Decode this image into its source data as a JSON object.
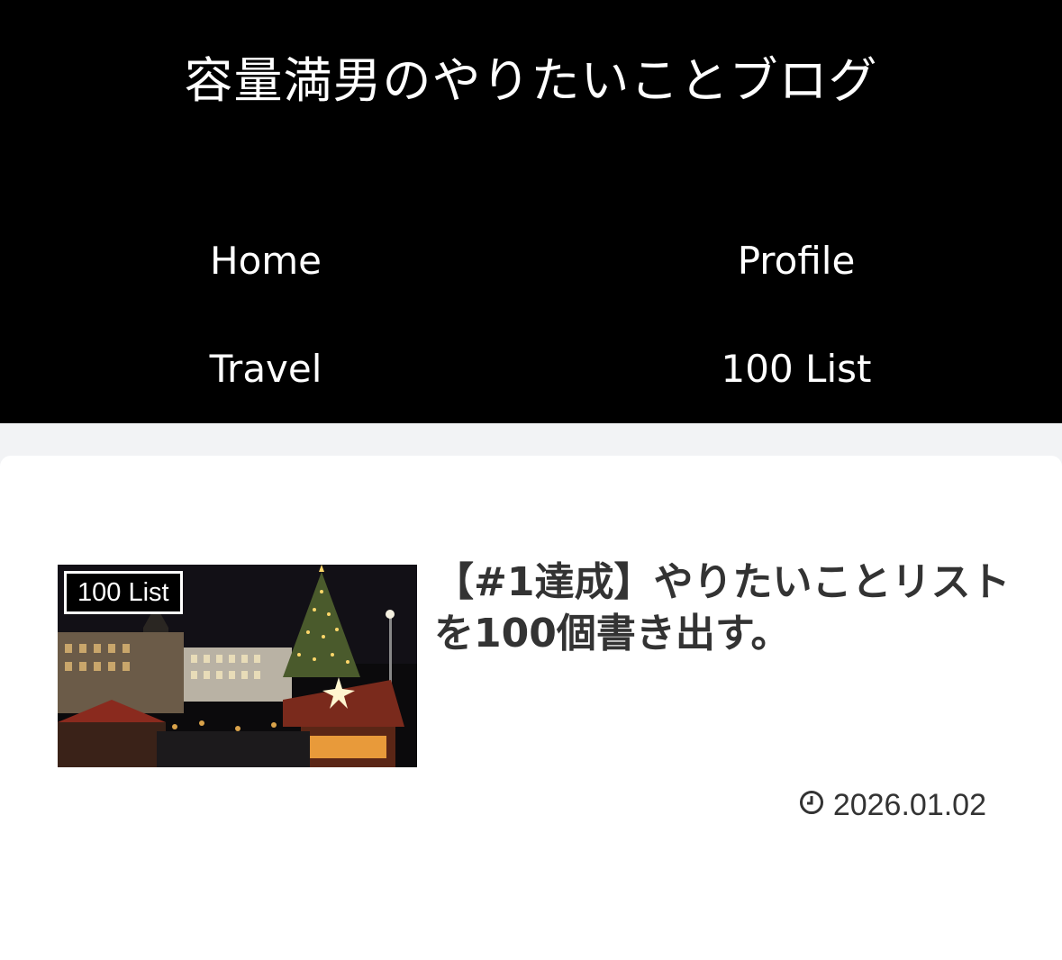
{
  "site": {
    "title": "容量満男のやりたいことブログ"
  },
  "nav": {
    "items": [
      {
        "label": "Home"
      },
      {
        "label": "Profile"
      },
      {
        "label": "Travel"
      },
      {
        "label": "100 List"
      }
    ]
  },
  "post": {
    "category": "100 List",
    "title": "【#1達成】やりたいことリストを100個書き出す。",
    "date": "2026.01.02",
    "thumbnail_icon": "christmas-market-photo"
  },
  "icons": {
    "date": "clock-icon"
  },
  "colors": {
    "header_bg": "#000000",
    "page_bg": "#f2f3f5",
    "card_bg": "#ffffff",
    "text": "#333333"
  }
}
